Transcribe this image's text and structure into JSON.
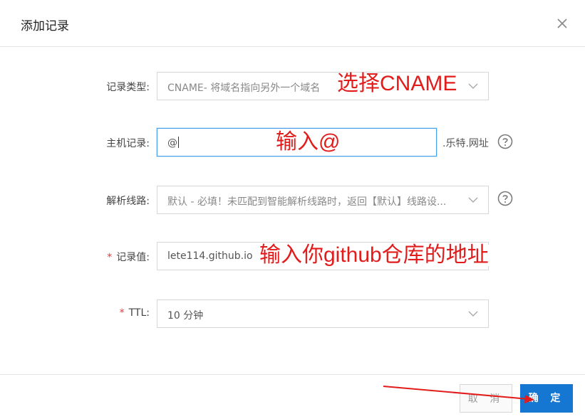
{
  "dialog": {
    "title": "添加记录",
    "close_icon": "close-icon"
  },
  "form": {
    "record_type": {
      "label": "记录类型",
      "value": "CNAME- 将域名指向另外一个域名"
    },
    "host": {
      "label": "主机记录",
      "value": "@",
      "suffix": ".乐特.网址"
    },
    "line": {
      "label": "解析线路",
      "value": "默认 - 必填！未匹配到智能解析线路时，返回【默认】线路设..."
    },
    "record_value": {
      "label": "记录值",
      "required": "*",
      "value": "lete114.github.io"
    },
    "ttl": {
      "label": "TTL",
      "required": "*",
      "value": "10 分钟"
    }
  },
  "annotations": {
    "select_cname": "选择CNAME",
    "enter_at": "输入@",
    "enter_repo": "输入你github仓库的地址"
  },
  "footer": {
    "cancel_label": "取 消",
    "ok_label": "确 定"
  },
  "colors": {
    "primary": "#1677d2",
    "annotation_red": "#e21b1b",
    "required_red": "#e0393e"
  }
}
